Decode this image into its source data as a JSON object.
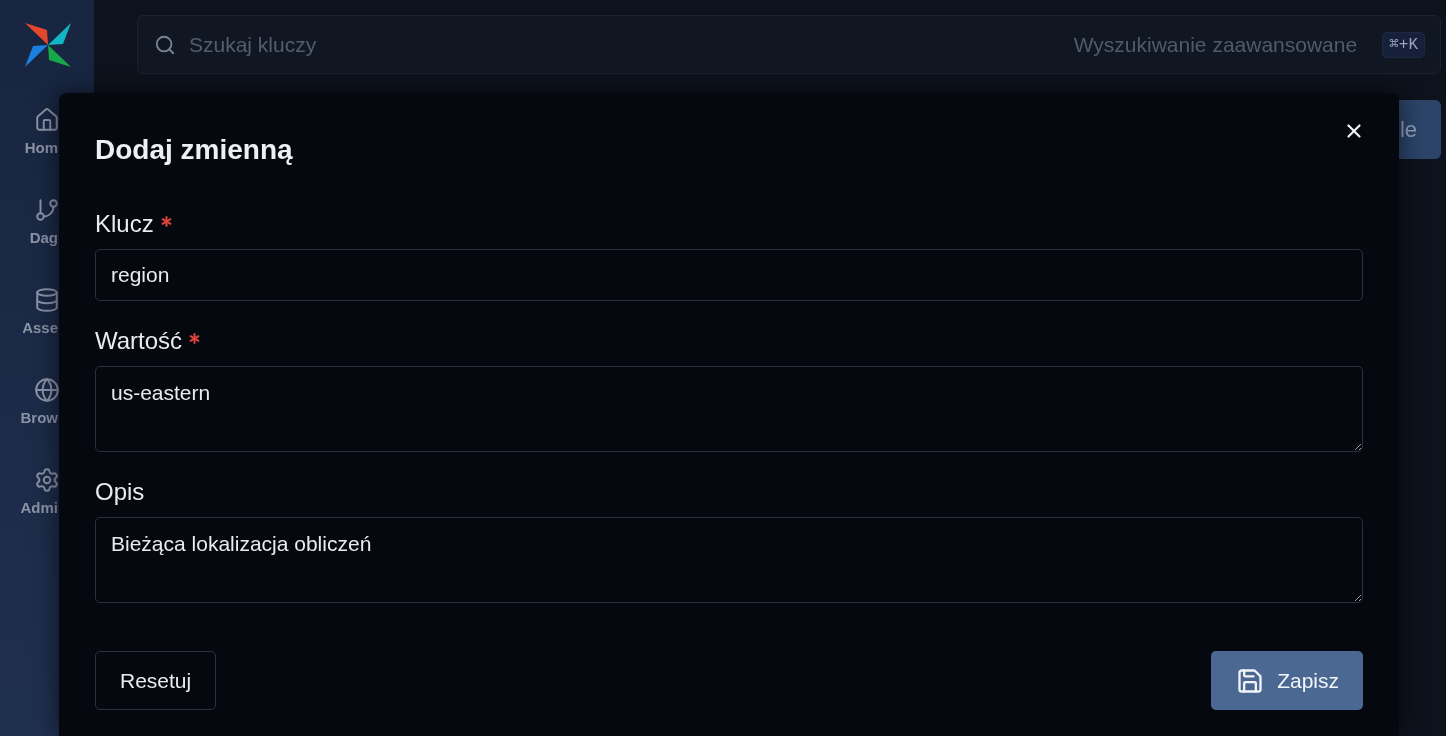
{
  "sidebar": {
    "items": [
      {
        "label": "Hom"
      },
      {
        "label": "Dag"
      },
      {
        "label": "Asse"
      },
      {
        "label": "Brow"
      },
      {
        "label": "Admi"
      }
    ]
  },
  "search": {
    "placeholder": "Szukaj kluczy",
    "advanced_link": "Wyszukiwanie zaawansowane",
    "shortcut": "⌘+K"
  },
  "header_button": {
    "label": "le"
  },
  "dialog": {
    "title": "Dodaj zmienną",
    "fields": [
      {
        "label": "Klucz",
        "required": true,
        "kind": "input",
        "value": "region"
      },
      {
        "label": "Wartość",
        "required": true,
        "kind": "textarea",
        "value": "us-eastern"
      },
      {
        "label": "Opis",
        "required": false,
        "kind": "textarea",
        "value": "Bieżąca lokalizacja obliczeń"
      }
    ],
    "buttons": [
      {
        "label": "Resetuj",
        "kind": "outline"
      },
      {
        "label": "Zapisz",
        "kind": "primary"
      }
    ]
  }
}
